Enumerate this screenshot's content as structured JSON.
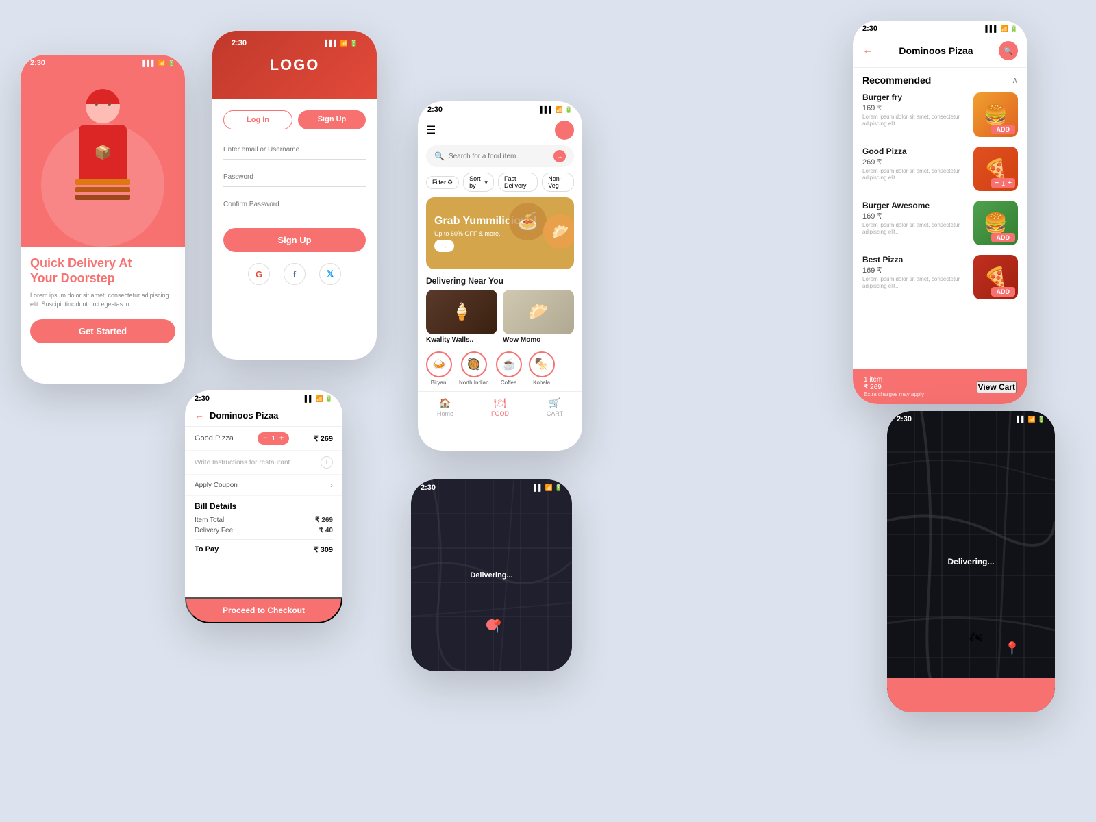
{
  "phone1": {
    "status_time": "2:30",
    "title_line1": "Quick Delivery At",
    "title_line2": "Your ",
    "title_highlight": "Doorstep",
    "description": "Lorem ipsum dolor sit amet, consectetur adipiscing elit. Suscipit tincidunt orci egestas in.",
    "cta_label": "Get Started"
  },
  "phone2": {
    "status_time": "2:30",
    "logo": "LOGO",
    "tab_login": "Log In",
    "tab_signup": "Sign Up",
    "input_email": "Enter email or Username",
    "input_password": "Password",
    "input_confirm": "Confirm Password",
    "signup_btn": "Sign Up",
    "social_google": "G",
    "social_facebook": "f",
    "social_twitter": "t"
  },
  "phone3": {
    "status_time": "2:30",
    "search_placeholder": "Search for a food item",
    "filter_label": "Filter",
    "sort_label": "Sort by",
    "fast_delivery": "Fast Delivery",
    "non_veg": "Non- Veg",
    "promo_title": "Grab Yummilicious!",
    "promo_subtitle": "Up to 60% OFF & more.",
    "promo_btn": "→",
    "section_nearby": "Delivering Near You",
    "restaurant1": "Kwality Walls..",
    "restaurant2": "Wow Momo",
    "categories": [
      "Biryani",
      "North Indian",
      "Coffee",
      "Kobala"
    ],
    "nav_home": "Home",
    "nav_food": "FOOD",
    "nav_cart": "CART"
  },
  "phone4": {
    "status_time": "2:30",
    "restaurant_name": "Dominoos Pizaa",
    "section_recommended": "Recommended",
    "items": [
      {
        "name": "Burger fry",
        "price": "169 ₹",
        "desc": "Lorem ipsum dolor sit amet, consectetur adipiscing elit...",
        "emoji": "🍔",
        "action": "ADD"
      },
      {
        "name": "Good Pizza",
        "price": "269 ₹",
        "desc": "Lorem ipsum dolor sit amet, consectetur adipiscing elit...",
        "emoji": "🍕",
        "action": "qty",
        "qty": "1"
      },
      {
        "name": "Burger Awesome",
        "price": "169 ₹",
        "desc": "Lorem ipsum dolor sit amet, consectetur adipiscing elit...",
        "emoji": "🍔",
        "action": "ADD"
      },
      {
        "name": "Best Pizza",
        "price": "169 ₹",
        "desc": "Lorem ipsum dolor sit amet, consectetur adipiscing elit...",
        "emoji": "🍕",
        "action": "ADD"
      }
    ],
    "cart_count": "1 item",
    "cart_price": "₹ 269",
    "cart_sub": "Extra charges may apply",
    "view_cart": "View Cart"
  },
  "phone5": {
    "restaurant_name": "Dominoos Pizaa",
    "item_name": "Good Pizza",
    "item_qty": "1",
    "item_price": "₹ 269",
    "instructions_placeholder": "Write Instructions for restaurant",
    "coupon_label": "Apply Coupon",
    "bill_title": "Bill Details",
    "item_total_label": "Item Total",
    "item_total": "₹ 269",
    "delivery_fee_label": "Delivery Fee",
    "delivery_fee": "₹ 40",
    "to_pay_label": "To Pay",
    "to_pay": "₹ 309",
    "proceed_btn": "Proceed to Checkout"
  },
  "phone6": {
    "status_time": "2:30",
    "delivering_text": "Delivering..."
  },
  "phone7": {
    "status_time": "2:30",
    "delivering_text": "Delivering..."
  }
}
